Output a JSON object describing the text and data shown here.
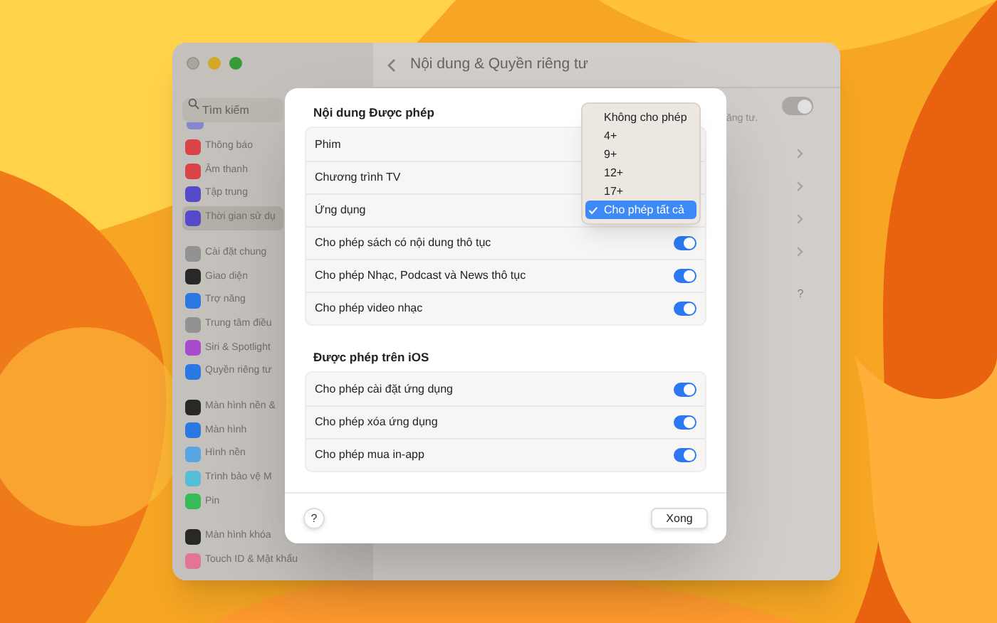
{
  "sidebar": {
    "search": {
      "placeholder": "Tìm kiếm"
    },
    "groups": [
      [
        {
          "label": "Thông báo",
          "color": "#e5484d",
          "selected": false
        },
        {
          "label": "Âm thanh",
          "color": "#e5484d",
          "selected": false
        },
        {
          "label": "Tập trung",
          "color": "#5b4fd6",
          "selected": false
        },
        {
          "label": "Thời gian sử dụ",
          "color": "#5b4fd6",
          "selected": true
        }
      ],
      [
        {
          "label": "Cài đặt chung",
          "color": "#9a9a9a",
          "selected": false
        },
        {
          "label": "Giao diện",
          "color": "#2b2b2b",
          "selected": false
        },
        {
          "label": "Trợ năng",
          "color": "#2f7ff0",
          "selected": false
        },
        {
          "label": "Trung tâm điều",
          "color": "#9a9a9a",
          "selected": false
        },
        {
          "label": "Siri & Spotlight",
          "color": "#b04fd6",
          "selected": false
        },
        {
          "label": "Quyền riêng tư",
          "color": "#2f7ff0",
          "selected": false
        }
      ],
      [
        {
          "label": "Màn hình nền &",
          "color": "#2b2b2b",
          "selected": false
        },
        {
          "label": "Màn hình",
          "color": "#2f7ff0",
          "selected": false
        },
        {
          "label": "Hình nền",
          "color": "#5ab0f0",
          "selected": false
        },
        {
          "label": "Trình bảo vệ M",
          "color": "#5ac8e0",
          "selected": false
        },
        {
          "label": "Pin",
          "color": "#3cc45a",
          "selected": false
        }
      ],
      [
        {
          "label": "Màn hình khóa",
          "color": "#2b2b2b",
          "selected": false
        },
        {
          "label": "Touch ID & Mật khẩu",
          "color": "#f07aa0",
          "selected": false
        }
      ]
    ]
  },
  "main": {
    "title": "Nội dung & Quyền riêng tư",
    "partial_text": "ăng tư.",
    "toggle_on": true,
    "help": "?"
  },
  "sheet": {
    "sections": [
      {
        "title": "Nội dung Được phép",
        "rows": [
          {
            "label": "Phim",
            "kind": "menu"
          },
          {
            "label": "Chương trình TV",
            "kind": "menu"
          },
          {
            "label": "Ứng dụng",
            "kind": "menu"
          },
          {
            "label": "Cho phép sách có nội dung thô tục",
            "kind": "toggle",
            "on": true
          },
          {
            "label": "Cho phép Nhạc, Podcast và News thô tục",
            "kind": "toggle",
            "on": true
          },
          {
            "label": "Cho phép video nhạc",
            "kind": "toggle",
            "on": true
          }
        ]
      },
      {
        "title": "Được phép trên iOS",
        "rows": [
          {
            "label": "Cho phép cài đặt ứng dụng",
            "kind": "toggle",
            "on": true
          },
          {
            "label": "Cho phép xóa ứng dụng",
            "kind": "toggle",
            "on": true
          },
          {
            "label": "Cho phép mua in-app",
            "kind": "toggle",
            "on": true
          }
        ]
      }
    ],
    "popup": {
      "items": [
        {
          "label": "Không cho phép",
          "selected": false
        },
        {
          "label": "4+",
          "selected": false
        },
        {
          "label": "9+",
          "selected": false
        },
        {
          "label": "12+",
          "selected": false
        },
        {
          "label": "17+",
          "selected": false
        },
        {
          "label": "Cho phép tất cả",
          "selected": true
        }
      ]
    },
    "help": "?",
    "done": "Xong"
  }
}
